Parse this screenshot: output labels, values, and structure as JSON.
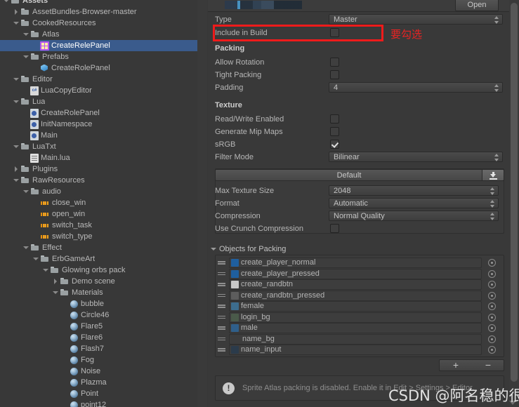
{
  "project": {
    "tree": [
      {
        "label": "Assets",
        "depth": 0,
        "twist": "down",
        "icon": "folder",
        "bold": true,
        "selected": false
      },
      {
        "label": "AssetBundles-Browser-master",
        "depth": 1,
        "twist": "right",
        "icon": "folder",
        "bold": false,
        "selected": false
      },
      {
        "label": "CookedResources",
        "depth": 1,
        "twist": "down",
        "icon": "folder",
        "bold": false,
        "selected": false
      },
      {
        "label": "Atlas",
        "depth": 2,
        "twist": "down",
        "icon": "folder",
        "bold": false,
        "selected": false
      },
      {
        "label": "CreateRelePanel",
        "depth": 3,
        "twist": "none",
        "icon": "atlas",
        "bold": false,
        "selected": true
      },
      {
        "label": "Prefabs",
        "depth": 2,
        "twist": "down",
        "icon": "folder",
        "bold": false,
        "selected": false
      },
      {
        "label": "CreateRolePanel",
        "depth": 3,
        "twist": "none",
        "icon": "prefab",
        "bold": false,
        "selected": false
      },
      {
        "label": "Editor",
        "depth": 1,
        "twist": "down",
        "icon": "folder",
        "bold": false,
        "selected": false
      },
      {
        "label": "LuaCopyEditor",
        "depth": 2,
        "twist": "none",
        "icon": "cs",
        "bold": false,
        "selected": false
      },
      {
        "label": "Lua",
        "depth": 1,
        "twist": "down",
        "icon": "folder",
        "bold": false,
        "selected": false
      },
      {
        "label": "CreateRolePanel",
        "depth": 2,
        "twist": "none",
        "icon": "lua",
        "bold": false,
        "selected": false
      },
      {
        "label": "InitNamespace",
        "depth": 2,
        "twist": "none",
        "icon": "lua",
        "bold": false,
        "selected": false
      },
      {
        "label": "Main",
        "depth": 2,
        "twist": "none",
        "icon": "lua",
        "bold": false,
        "selected": false
      },
      {
        "label": "LuaTxt",
        "depth": 1,
        "twist": "down",
        "icon": "folder",
        "bold": false,
        "selected": false
      },
      {
        "label": "Main.lua",
        "depth": 2,
        "twist": "none",
        "icon": "txt",
        "bold": false,
        "selected": false
      },
      {
        "label": "Plugins",
        "depth": 1,
        "twist": "right",
        "icon": "folder",
        "bold": false,
        "selected": false
      },
      {
        "label": "RawResources",
        "depth": 1,
        "twist": "down",
        "icon": "folder",
        "bold": false,
        "selected": false
      },
      {
        "label": "audio",
        "depth": 2,
        "twist": "down",
        "icon": "folder",
        "bold": false,
        "selected": false
      },
      {
        "label": "close_win",
        "depth": 3,
        "twist": "none",
        "icon": "audio",
        "bold": false,
        "selected": false
      },
      {
        "label": "open_win",
        "depth": 3,
        "twist": "none",
        "icon": "audio",
        "bold": false,
        "selected": false
      },
      {
        "label": "switch_task",
        "depth": 3,
        "twist": "none",
        "icon": "audio",
        "bold": false,
        "selected": false
      },
      {
        "label": "switch_type",
        "depth": 3,
        "twist": "none",
        "icon": "audio",
        "bold": false,
        "selected": false
      },
      {
        "label": "Effect",
        "depth": 2,
        "twist": "down",
        "icon": "folder",
        "bold": false,
        "selected": false
      },
      {
        "label": "ErbGameArt",
        "depth": 3,
        "twist": "down",
        "icon": "folder",
        "bold": false,
        "selected": false
      },
      {
        "label": "Glowing orbs pack",
        "depth": 4,
        "twist": "down",
        "icon": "folder",
        "bold": false,
        "selected": false
      },
      {
        "label": "Demo scene",
        "depth": 5,
        "twist": "right",
        "icon": "folder",
        "bold": false,
        "selected": false
      },
      {
        "label": "Materials",
        "depth": 5,
        "twist": "down",
        "icon": "folder",
        "bold": false,
        "selected": false
      },
      {
        "label": "bubble",
        "depth": 6,
        "twist": "none",
        "icon": "mat",
        "bold": false,
        "selected": false
      },
      {
        "label": "Circle46",
        "depth": 6,
        "twist": "none",
        "icon": "mat",
        "bold": false,
        "selected": false
      },
      {
        "label": "Flare5",
        "depth": 6,
        "twist": "none",
        "icon": "mat",
        "bold": false,
        "selected": false
      },
      {
        "label": "Flare6",
        "depth": 6,
        "twist": "none",
        "icon": "mat",
        "bold": false,
        "selected": false
      },
      {
        "label": "Flash7",
        "depth": 6,
        "twist": "none",
        "icon": "mat",
        "bold": false,
        "selected": false
      },
      {
        "label": "Fog",
        "depth": 6,
        "twist": "none",
        "icon": "mat",
        "bold": false,
        "selected": false
      },
      {
        "label": "Noise",
        "depth": 6,
        "twist": "none",
        "icon": "mat",
        "bold": false,
        "selected": false
      },
      {
        "label": "Plazma",
        "depth": 6,
        "twist": "none",
        "icon": "mat",
        "bold": false,
        "selected": false
      },
      {
        "label": "Point",
        "depth": 6,
        "twist": "none",
        "icon": "mat",
        "bold": false,
        "selected": false
      },
      {
        "label": "point12",
        "depth": 6,
        "twist": "none",
        "icon": "mat",
        "bold": false,
        "selected": false
      }
    ]
  },
  "inspector": {
    "open_label": "Open",
    "type": {
      "label": "Type",
      "value": "Master"
    },
    "include_in_build": {
      "label": "Include in Build",
      "checked": false
    },
    "packing": {
      "header": "Packing",
      "allow_rotation": {
        "label": "Allow Rotation",
        "checked": false
      },
      "tight_packing": {
        "label": "Tight Packing",
        "checked": false
      },
      "padding": {
        "label": "Padding",
        "value": "4"
      }
    },
    "texture": {
      "header": "Texture",
      "read_write_enabled": {
        "label": "Read/Write Enabled",
        "checked": false
      },
      "generate_mip_maps": {
        "label": "Generate Mip Maps",
        "checked": false
      },
      "srgb": {
        "label": "sRGB",
        "checked": true
      },
      "filter_mode": {
        "label": "Filter Mode",
        "value": "Bilinear"
      }
    },
    "platform": {
      "name": "Default",
      "max_texture_size": {
        "label": "Max Texture Size",
        "value": "2048"
      },
      "format": {
        "label": "Format",
        "value": "Automatic"
      },
      "compression": {
        "label": "Compression",
        "value": "Normal Quality"
      },
      "use_crunch_compression": {
        "label": "Use Crunch Compression",
        "checked": false
      }
    },
    "objects_for_packing": {
      "header": "Objects for Packing",
      "items": [
        {
          "name": "create_player_normal",
          "thumb": "#1f5f9e"
        },
        {
          "name": "create_player_pressed",
          "thumb": "#1f5f9e"
        },
        {
          "name": "create_randbtn",
          "thumb": "#c8c8c8"
        },
        {
          "name": "create_randbtn_pressed",
          "thumb": "#5d5d5d"
        },
        {
          "name": "female",
          "thumb": "#3d6d8e"
        },
        {
          "name": "login_bg",
          "thumb": "#4a5a4a"
        },
        {
          "name": "male",
          "thumb": "#2f5f8a"
        },
        {
          "name": "name_bg",
          "thumb": "none"
        },
        {
          "name": "name_input",
          "thumb": "#2b3b4b"
        }
      ],
      "add_label": "+",
      "remove_label": "−"
    },
    "warning": "Sprite Atlas packing is disabled. Enable it in Edit > Settings > Editor."
  },
  "annotations": {
    "highlight_note": "要勾选",
    "watermark": "CSDN @阿名稳的很",
    "highlight_color": "#ef1b1b"
  }
}
